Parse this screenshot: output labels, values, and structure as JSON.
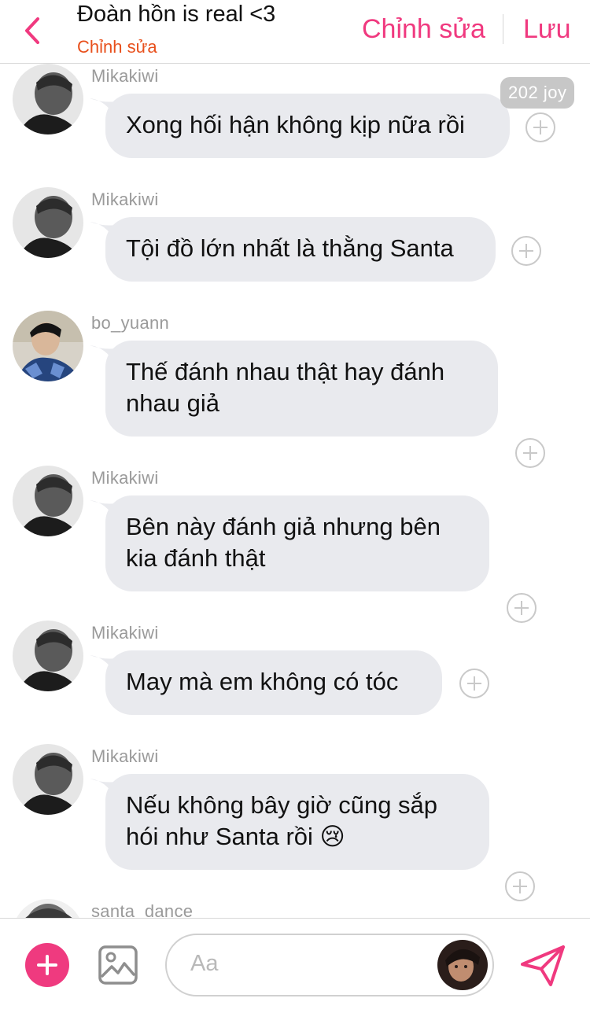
{
  "header": {
    "title": "Đoàn hồn is real <3",
    "subtitle": "Chỉnh sửa",
    "edit_label": "Chỉnh sửa",
    "save_label": "Lưu",
    "accent_color": "#f0397f"
  },
  "badge": {
    "joy": "202 joy"
  },
  "messages": [
    {
      "user": "Mikakiwi",
      "lines": [
        "Xong hối hận không kịp nữa rồi"
      ]
    },
    {
      "user": "Mikakiwi",
      "lines": [
        "Tội đồ lớn nhất là thằng Santa"
      ]
    },
    {
      "user": "bo_yuann",
      "lines": [
        "Thế đánh nhau thật hay đánh",
        "nhau giả"
      ]
    },
    {
      "user": "Mikakiwi",
      "lines": [
        "Bên này đánh giả nhưng bên",
        "kia đánh thật"
      ]
    },
    {
      "user": "Mikakiwi",
      "lines": [
        "May mà em không có tóc"
      ]
    },
    {
      "user": "Mikakiwi",
      "lines": [
        "Nếu không bây giờ cũng sắp",
        "hói như Santa rồi 😢"
      ]
    },
    {
      "user": "santa_dance",
      "lines": []
    }
  ],
  "composer": {
    "placeholder": "Aa"
  },
  "icons": {
    "back": "chevron-left-icon",
    "add": "plus-icon",
    "image": "image-icon",
    "send": "send-icon",
    "react": "plus-circle-icon"
  }
}
